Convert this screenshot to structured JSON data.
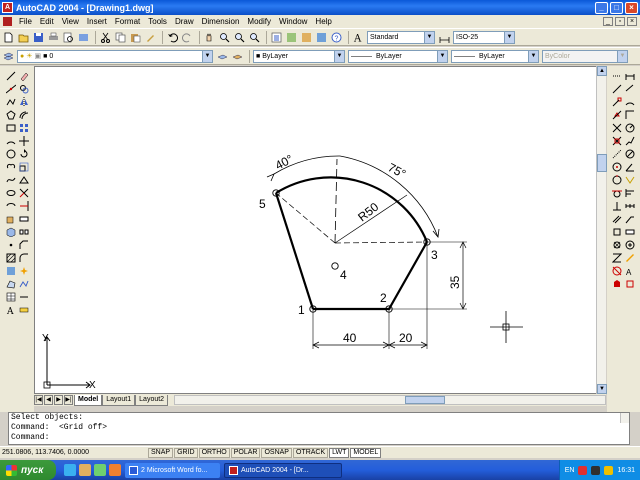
{
  "window": {
    "title": "AutoCAD 2004 - [Drawing1.dwg]",
    "app_icon_text": "A"
  },
  "menu": [
    "File",
    "Edit",
    "View",
    "Insert",
    "Format",
    "Tools",
    "Draw",
    "Dimension",
    "Modify",
    "Window",
    "Help"
  ],
  "toolbar_standard": {
    "text_style": "Standard",
    "dim_style": "ISO-25"
  },
  "toolbar_properties": {
    "layer": "0",
    "color": "ByLayer",
    "linetype": "ByLayer",
    "lineweight": "ByLayer",
    "plotstyle": "ByColor"
  },
  "layout_tabs": [
    "Model",
    "Layout1",
    "Layout2"
  ],
  "drawing": {
    "points": [
      "1",
      "2",
      "3",
      "4",
      "5"
    ],
    "dims": {
      "angle_40": "40°",
      "angle_75": "75°",
      "radius": "R50",
      "vertical_35": "35",
      "horizontal_40": "40",
      "horizontal_20": "20"
    },
    "ucs": {
      "x": "X",
      "y": "Y"
    }
  },
  "command_lines": [
    "Select objects:",
    "Command:  <Grid off>",
    "Command:"
  ],
  "status": {
    "coords": "251.0806, 113.7406, 0.0000",
    "buttons": [
      "SNAP",
      "GRID",
      "ORTHO",
      "POLAR",
      "OSNAP",
      "OTRACK",
      "LWT",
      "MODEL"
    ]
  },
  "taskbar": {
    "start_label": "пуск",
    "tasks": [
      "2 Microsoft Word fo...",
      "AutoCAD 2004 - [Dr..."
    ],
    "lang": "EN",
    "clock": "16:31"
  }
}
